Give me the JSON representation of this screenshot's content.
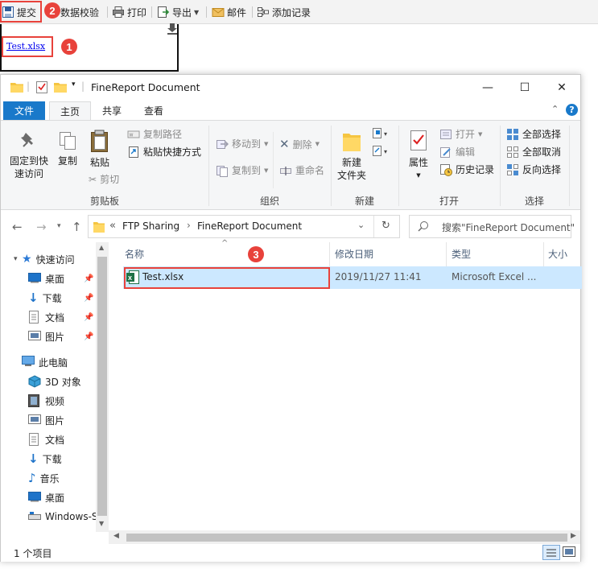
{
  "toolbar": {
    "submit": "提交",
    "validate": "数据校验",
    "print": "打印",
    "export": "导出",
    "mail": "邮件",
    "add_record": "添加记录"
  },
  "cell": {
    "link": "Test.xlsx"
  },
  "badges": {
    "one": "1",
    "two": "2",
    "three": "3"
  },
  "explorer": {
    "title": "FineReport Document",
    "tabs": [
      "文件",
      "主页",
      "共享",
      "查看"
    ],
    "ribbon": {
      "clipboard": {
        "pin": "固定到快\n速访问",
        "copy": "复制",
        "paste": "粘贴",
        "copy_path": "复制路径",
        "paste_shortcut": "粘贴快捷方式",
        "cut": "剪切",
        "label": "剪贴板"
      },
      "organize": {
        "move_to": "移动到",
        "copy_to": "复制到",
        "delete": "删除",
        "rename": "重命名",
        "label": "组织"
      },
      "new": {
        "new_folder": "新建\n文件夹",
        "label": "新建"
      },
      "open": {
        "properties": "属性",
        "open": "打开",
        "edit": "编辑",
        "history": "历史记录",
        "label": "打开"
      },
      "select": {
        "select_all": "全部选择",
        "select_none": "全部取消",
        "invert": "反向选择",
        "label": "选择"
      }
    },
    "address": {
      "prefix": "«",
      "segments": [
        "FTP Sharing",
        "FineReport Document"
      ],
      "search_placeholder": "搜索\"FineReport Document\""
    },
    "nav": {
      "quick_access": "快速访问",
      "quick_items": [
        "桌面",
        "下载",
        "文档",
        "图片"
      ],
      "this_pc": "此电脑",
      "pc_items": [
        "3D 对象",
        "视频",
        "图片",
        "文档",
        "下载",
        "音乐",
        "桌面",
        "Windows-S"
      ]
    },
    "columns": [
      "名称",
      "修改日期",
      "类型",
      "大小"
    ],
    "files": [
      {
        "name": "Test.xlsx",
        "modified": "2019/11/27 11:41",
        "type": "Microsoft Excel ..."
      }
    ],
    "status": "1 个项目"
  },
  "colors": {
    "accent": "#1979ca",
    "highlight": "#e8423b",
    "selection": "#cce8ff"
  }
}
